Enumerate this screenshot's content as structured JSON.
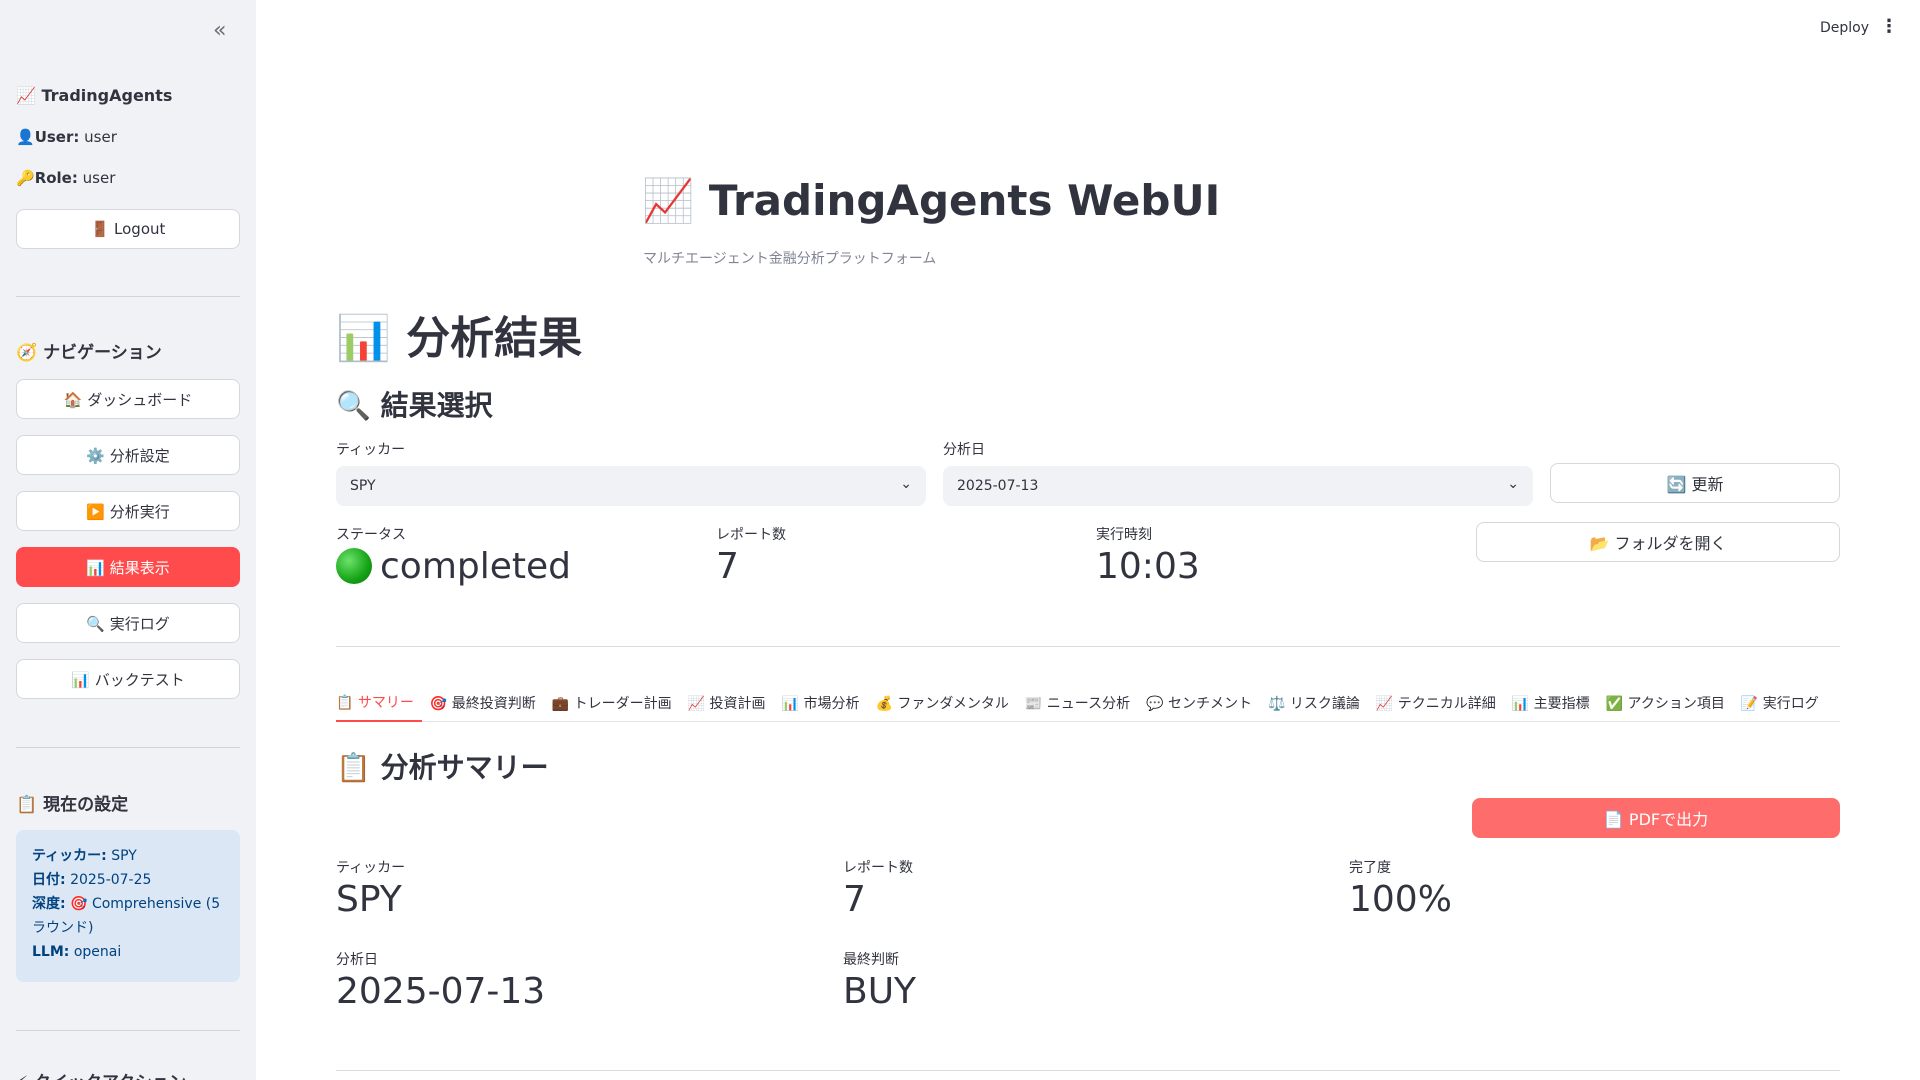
{
  "sidebar": {
    "collapse_icon": "«",
    "app_name": "📈 TradingAgents",
    "user_label": "User:",
    "user_value": "user",
    "role_label": "Role:",
    "role_value": "user",
    "logout": "🚪 Logout",
    "nav_title": "🧭 ナビゲーション",
    "nav": {
      "dashboard": "🏠 ダッシュボード",
      "settings": "⚙️ 分析設定",
      "run": "▶️ 分析実行",
      "results": "📊 結果表示",
      "logs": "🔍 実行ログ",
      "backtest": "📊 バックテスト"
    },
    "config_title": "📋 現在の設定",
    "config": {
      "ticker_label": "ティッカー:",
      "ticker": "SPY",
      "date_label": "日付:",
      "date": "2025-07-25",
      "depth_label": "深度:",
      "depth": "🎯 Comprehensive (5 ラウンド)",
      "llm_label": "LLM:",
      "llm": "openai"
    },
    "quick_title": "⚡ クイックアクション"
  },
  "topbar": {
    "deploy": "Deploy",
    "menu_icon": "⋮"
  },
  "header": {
    "title": "📈 TradingAgents WebUI",
    "subtitle": "マルチエージェント金融分析プラットフォーム"
  },
  "main": {
    "page_title": "📊 分析結果",
    "select_title": "🔍 結果選択",
    "ticker_label": "ティッカー",
    "ticker_value": "SPY",
    "date_label": "分析日",
    "date_value": "2025-07-13",
    "refresh": "🔄 更新",
    "open_folder": "📂 フォルダを開く",
    "metrics": {
      "status_label": "ステータス",
      "status_value": "completed",
      "reports_label": "レポート数",
      "reports_value": "7",
      "time_label": "実行時刻",
      "time_value": "10:03"
    },
    "tabs": [
      "📋 サマリー",
      "🎯 最終投資判断",
      "💼 トレーダー計画",
      "📈 投資計画",
      "📊 市場分析",
      "💰 ファンダメンタル",
      "📰 ニュース分析",
      "💬 センチメント",
      "⚖️ リスク議論",
      "📈 テクニカル詳細",
      "📊 主要指標",
      "✅ アクション項目",
      "📝 実行ログ"
    ],
    "summary": {
      "title": "📋 分析サマリー",
      "pdf_button": "📄 PDFで出力",
      "ticker_label": "ティッカー",
      "ticker_value": "SPY",
      "reports_label": "レポート数",
      "reports_value": "7",
      "completion_label": "完了度",
      "completion_value": "100%",
      "date_label": "分析日",
      "date_value": "2025-07-13",
      "decision_label": "最終判断",
      "decision_value": "BUY"
    }
  }
}
